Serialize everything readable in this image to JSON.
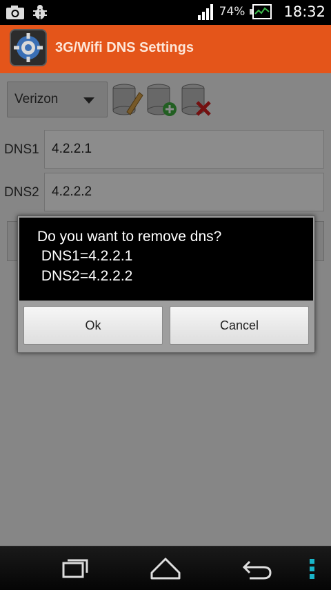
{
  "status_bar": {
    "left_icons": [
      "camera-icon",
      "bug-icon"
    ],
    "signal_icon": "signal-icon",
    "battery_text": "74%",
    "battery_icon": "battery-icon",
    "time": "18:32"
  },
  "app": {
    "title": "3G/Wifi DNS Settings",
    "icon": "gear-globe-icon",
    "accent": "#e4551a"
  },
  "form": {
    "provider_selected": "Verizon",
    "toolbar_icons": [
      "edit-dns-icon",
      "add-dns-icon",
      "delete-dns-icon"
    ],
    "dns1_label": "DNS1",
    "dns1_value": "4.2.2.1",
    "dns2_label": "DNS2",
    "dns2_value": "4.2.2.2"
  },
  "dialog": {
    "line1": "Do you want to remove dns?",
    "line2": " DNS1=4.2.2.1",
    "line3": " DNS2=4.2.2.2",
    "ok_label": "Ok",
    "cancel_label": "Cancel"
  },
  "nav_bar": {
    "icons": [
      "recent-apps-icon",
      "home-icon",
      "back-icon",
      "menu-icon"
    ],
    "accent": "#19b4c8"
  }
}
